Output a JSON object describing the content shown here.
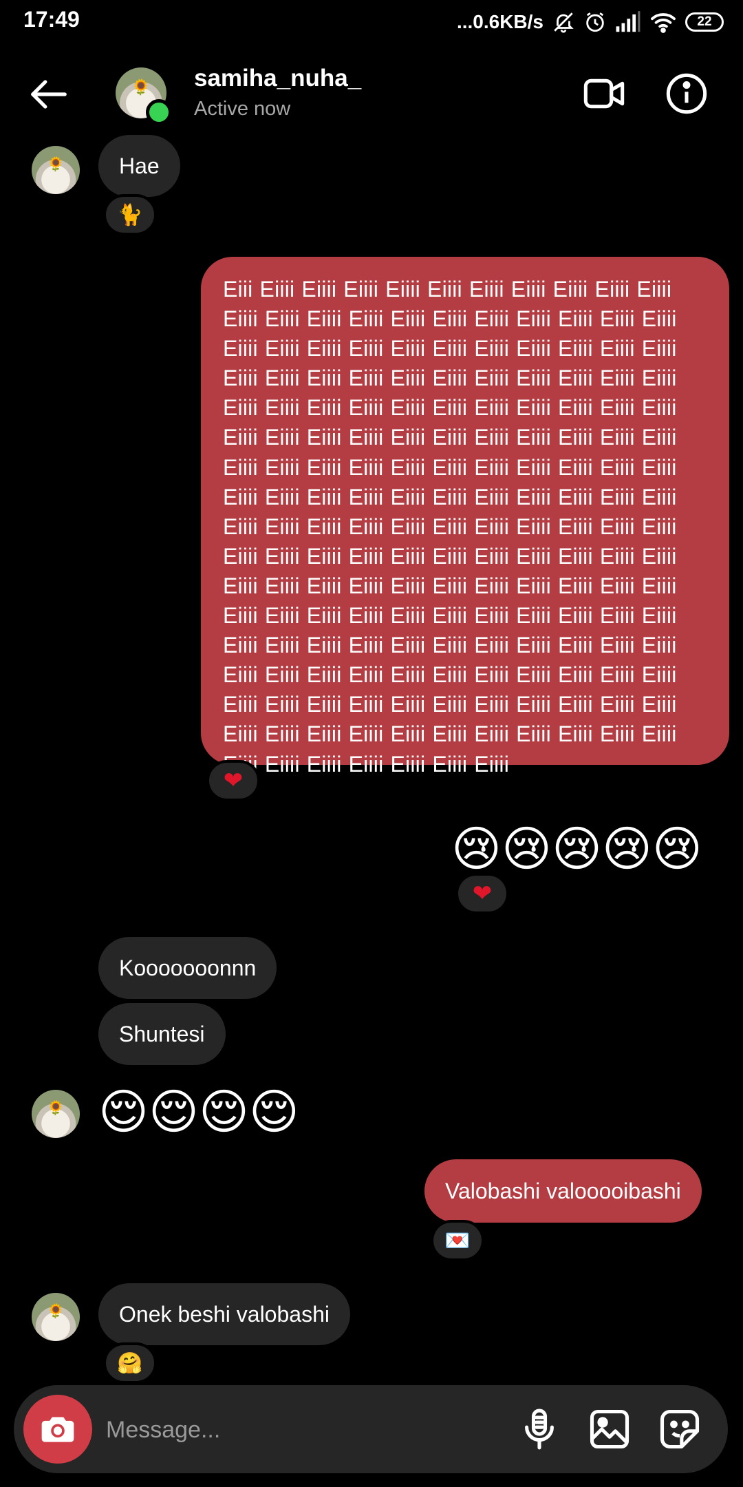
{
  "status_bar": {
    "time": "17:49",
    "network_speed": "...0.6KB/s",
    "battery": "22"
  },
  "header": {
    "username": "samiha_nuha_",
    "status": "Active now",
    "icons": [
      "back-arrow-icon",
      "video-call-icon",
      "info-icon"
    ]
  },
  "messages": {
    "m1": {
      "text": "Hae",
      "reaction": "🐈"
    },
    "m2": {
      "text": "Eiii Eiiii Eiiii Eiiii Eiiii Eiiii Eiiii Eiiii Eiiii Eiiii Eiiii Eiiii Eiiii Eiiii Eiiii Eiiii Eiiii Eiiii Eiiii Eiiii Eiiii Eiiii Eiiii Eiiii Eiiii Eiiii Eiiii Eiiii Eiiii Eiiii Eiiii Eiiii Eiiii Eiiii Eiiii Eiiii Eiiii Eiiii Eiiii Eiiii Eiiii Eiiii Eiiii Eiiii Eiiii Eiiii Eiiii Eiiii Eiiii Eiiii Eiiii Eiiii Eiiii Eiiii Eiiii Eiiii Eiiii Eiiii Eiiii Eiiii Eiiii Eiiii Eiiii Eiiii Eiiii Eiiii Eiiii Eiiii Eiiii Eiiii Eiiii Eiiii Eiiii Eiiii Eiiii Eiiii Eiiii Eiiii Eiiii Eiiii Eiiii Eiiii Eiiii Eiiii Eiiii Eiiii Eiiii Eiiii Eiiii Eiiii Eiiii Eiiii Eiiii Eiiii Eiiii Eiiii Eiiii Eiiii Eiiii Eiiii Eiiii Eiiii Eiiii Eiiii Eiiii Eiiii Eiiii Eiiii Eiiii Eiiii Eiiii Eiiii Eiiii Eiiii Eiiii Eiiii Eiiii Eiiii Eiiii Eiiii Eiiii Eiiii Eiiii Eiiii Eiiii Eiiii Eiiii Eiiii Eiiii Eiiii Eiiii Eiiii Eiiii Eiiii Eiiii Eiiii Eiiii Eiiii Eiiii Eiiii Eiiii Eiiii Eiiii Eiiii Eiiii Eiiii Eiiii Eiiii Eiiii Eiiii Eiiii Eiiii Eiiii Eiiii Eiiii Eiiii Eiiii Eiiii Eiiii Eiiii Eiiii Eiiii Eiiii Eiiii Eiiii Eiiii Eiiii Eiiii Eiiii Eiiii Eiiii Eiiii Eiiii Eiiii Eiiii Eiiii Eiiii Eiiii Eiiii Eiiii Eiiii Eiiii Eiiii",
      "reaction": "❤"
    },
    "m3": {
      "text": "😢😢😢😢😢",
      "reaction": "❤"
    },
    "m4": {
      "text": "Kooooooonnn"
    },
    "m5": {
      "text": "Shuntesi"
    },
    "m6": {
      "text": "😌😌😌😌"
    },
    "m7": {
      "text": "Valobashi valooooibashi",
      "reaction": "💌"
    },
    "m8": {
      "text": "Onek beshi valobashi",
      "reaction": "🤗"
    }
  },
  "composer": {
    "placeholder": "Message...",
    "icons": [
      "camera-icon",
      "microphone-icon",
      "gallery-icon",
      "sticker-icon"
    ]
  },
  "colors": {
    "background": "#000000",
    "incoming_bubble": "#262626",
    "outgoing_bubble": "#b33d42",
    "online": "#39d353",
    "camera_button": "#d13d46"
  }
}
